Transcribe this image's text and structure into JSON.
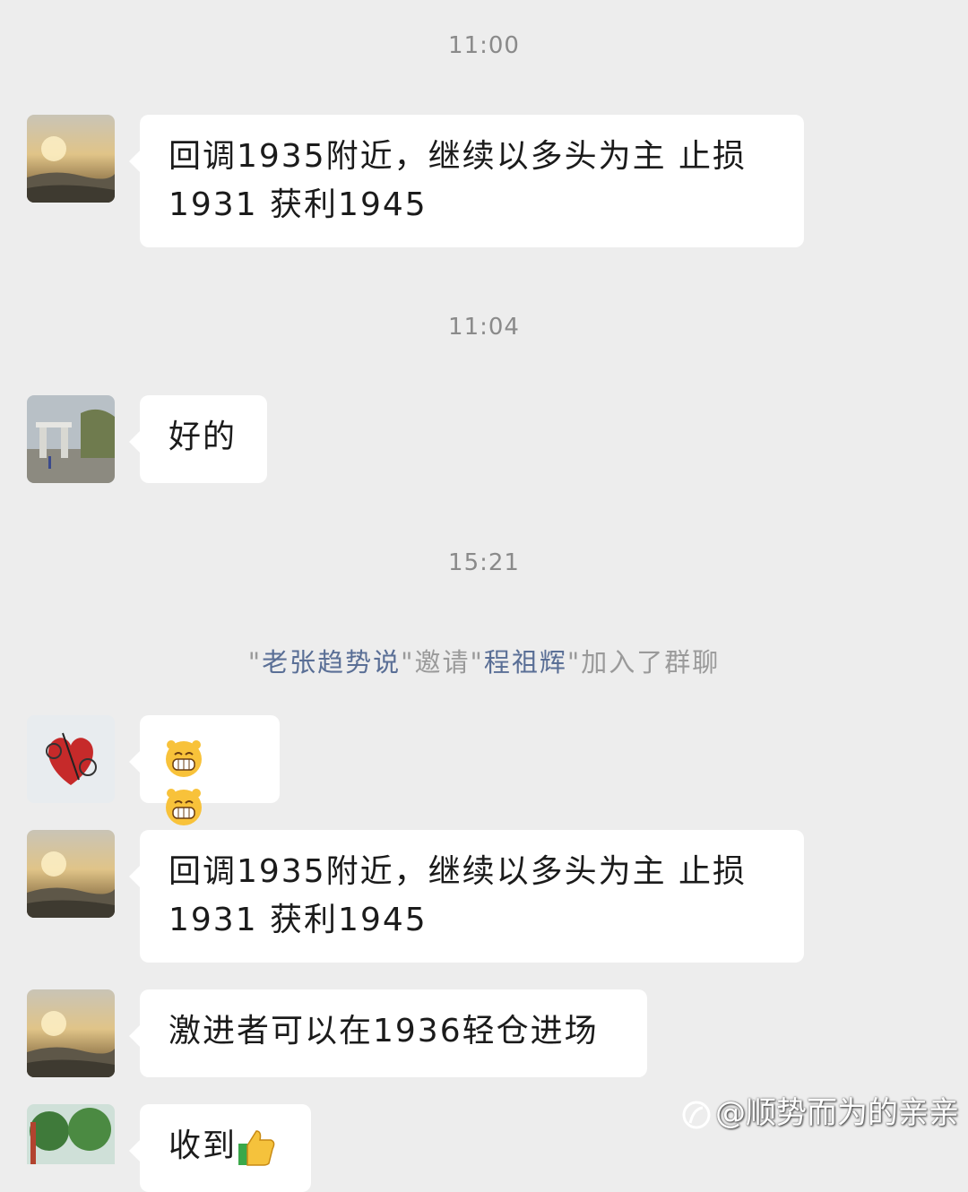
{
  "timestamps": [
    "11:00",
    "11:04",
    "15:21"
  ],
  "system_notice": {
    "quote1": "\"",
    "inviter": "老张趋势说",
    "mid": "\"邀请\"",
    "invitee": "程祖辉",
    "tail": "\"加入了群聊"
  },
  "messages": [
    {
      "line1": "回调1935附近，继续以多头为主 止损",
      "line2": "1931 获利1945"
    },
    {
      "text": "好的"
    },
    {
      "emoji": "grinning-cat-emoji x2"
    },
    {
      "line1": "回调1935附近，继续以多头为主 止损",
      "line2": "1931 获利1945"
    },
    {
      "text": "激进者可以在1936轻仓进场"
    },
    {
      "text": "收到",
      "emoji": "thumbs-up-icon"
    }
  ],
  "watermark": {
    "text": "@顺势而为的亲亲"
  },
  "colors": {
    "background": "#ededed",
    "bubble": "#ffffff",
    "name_link": "#5a6f96"
  }
}
